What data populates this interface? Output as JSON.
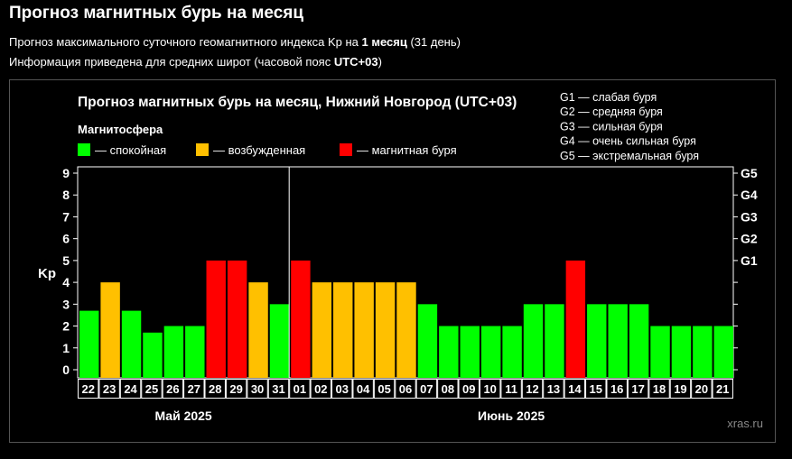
{
  "header": {
    "title": "Прогноз магнитных бурь на месяц",
    "line1_pre": "Прогноз максимального суточного геомагнитного индекса Kp на ",
    "line1_bold": "1 месяц",
    "line1_post": " (31 день)",
    "line2_pre": "Информация приведена для средних широт (часовой пояс ",
    "line2_bold": "UTC+03",
    "line2_post": ")"
  },
  "colors": {
    "calm": "#00ff00",
    "excited": "#ffc000",
    "storm": "#ff0000",
    "background": "#000000",
    "panel_border": "#555555"
  },
  "chart_data": {
    "type": "bar",
    "title": "Прогноз магнитных бурь на месяц, Нижний Новгород (UTC+03)",
    "legend_title": "Магнитосфера",
    "legend": [
      {
        "key": "calm",
        "label": "— спокойная"
      },
      {
        "key": "excited",
        "label": "— возбужденная"
      },
      {
        "key": "storm",
        "label": "— магнитная буря"
      }
    ],
    "g_legend": [
      "G1 — слабая буря",
      "G2 — средняя буря",
      "G3 — сильная буря",
      "G4 — очень сильная буря",
      "G5 — экстремальная буря"
    ],
    "ylabel": "Kp",
    "ylim": [
      0,
      9
    ],
    "yticks": [
      0,
      1,
      2,
      3,
      4,
      5,
      6,
      7,
      8,
      9
    ],
    "g_levels": [
      {
        "label": "G1",
        "kp": 5
      },
      {
        "label": "G2",
        "kp": 6
      },
      {
        "label": "G3",
        "kp": 7
      },
      {
        "label": "G4",
        "kp": 8
      },
      {
        "label": "G5",
        "kp": 9
      }
    ],
    "categories": [
      "22",
      "23",
      "24",
      "25",
      "26",
      "27",
      "28",
      "29",
      "30",
      "31",
      "01",
      "02",
      "03",
      "04",
      "05",
      "06",
      "07",
      "08",
      "09",
      "10",
      "11",
      "12",
      "13",
      "14",
      "15",
      "16",
      "17",
      "18",
      "19",
      "20",
      "21"
    ],
    "values": [
      2.7,
      4,
      2.7,
      1.7,
      2,
      2,
      5,
      5,
      4,
      3,
      5,
      4,
      4,
      4,
      4,
      4,
      3,
      2,
      2,
      2,
      2,
      3,
      3,
      5,
      3,
      3,
      3,
      2,
      2,
      2,
      2
    ],
    "status": [
      "calm",
      "excited",
      "calm",
      "calm",
      "calm",
      "calm",
      "storm",
      "storm",
      "excited",
      "calm",
      "storm",
      "excited",
      "excited",
      "excited",
      "excited",
      "excited",
      "calm",
      "calm",
      "calm",
      "calm",
      "calm",
      "calm",
      "calm",
      "storm",
      "calm",
      "calm",
      "calm",
      "calm",
      "calm",
      "calm",
      "calm"
    ],
    "months": [
      {
        "label": "Май 2025",
        "start": 0,
        "end": 9
      },
      {
        "label": "Июнь 2025",
        "start": 10,
        "end": 30
      }
    ],
    "watermark": "xras.ru"
  }
}
